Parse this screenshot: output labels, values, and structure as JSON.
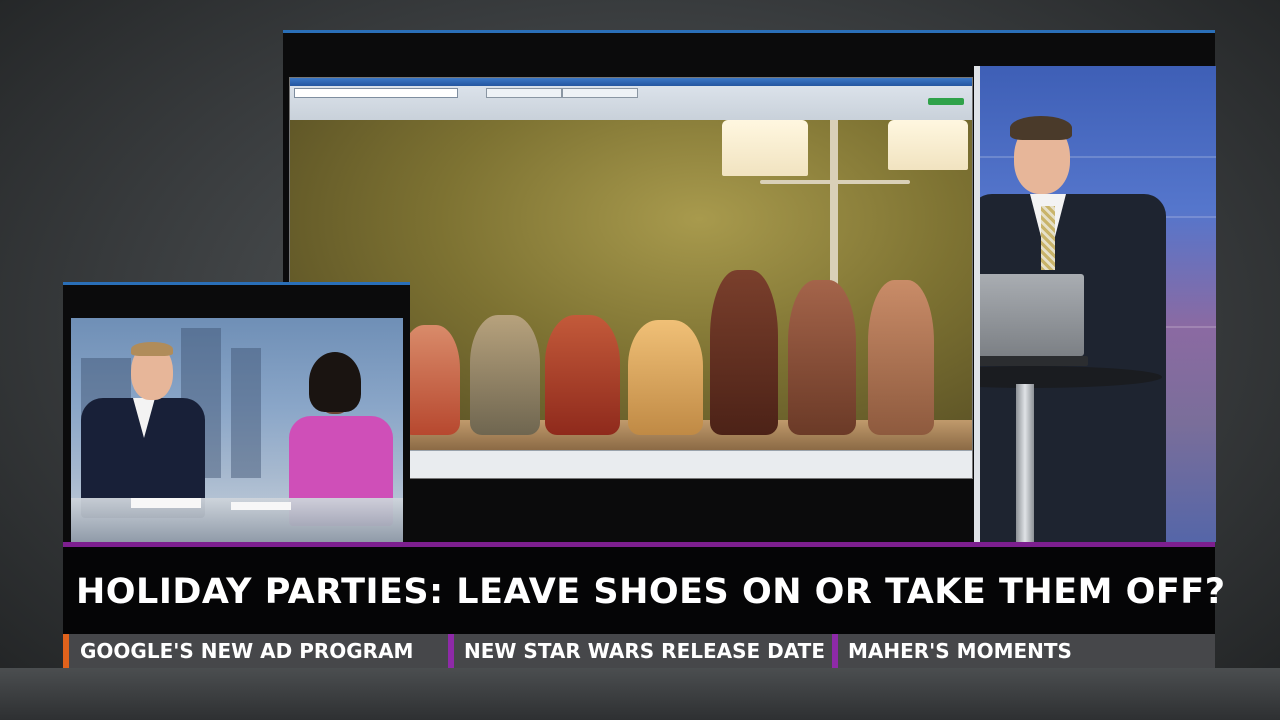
{
  "lower_third": {
    "headline": "HOLIDAY PARTIES: LEAVE SHOES ON OR TAKE THEM OFF?",
    "accent_color": "#7d1f8f",
    "ticker": [
      {
        "label": "GOOGLE'S NEW AD PROGRAM",
        "marker_color": "#e0621c"
      },
      {
        "label": "NEW STAR WARS RELEASE DATE",
        "marker_color": "#8e2aa8"
      },
      {
        "label": "MAHER'S MOMENTS",
        "marker_color": "#8e2aa8"
      }
    ]
  },
  "colors": {
    "frame_border": "#2a6fb8",
    "headline_bg": "#050506",
    "ticker_bg": "#46474a"
  }
}
